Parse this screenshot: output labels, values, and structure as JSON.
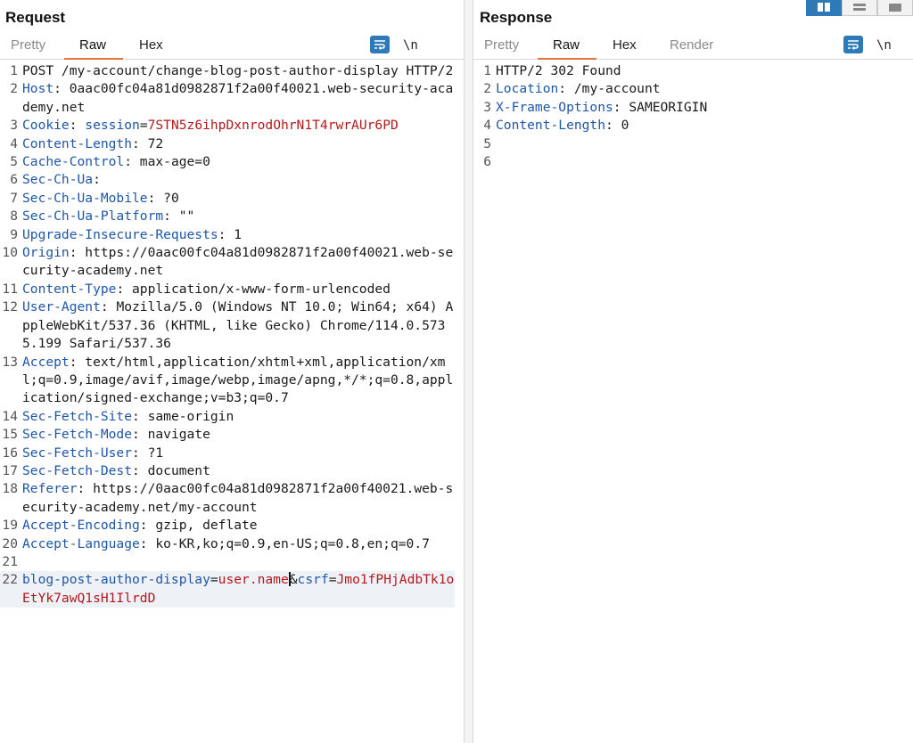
{
  "request": {
    "title": "Request",
    "tabs": [
      {
        "label": "Pretty",
        "active": false
      },
      {
        "label": "Raw",
        "active": true
      },
      {
        "label": "Hex",
        "active": false
      }
    ],
    "tools": {
      "wrap_icon": "wrap-lines-icon",
      "newline_label": "\\n",
      "menu_icon": "hamburger-menu-icon"
    },
    "lines": [
      {
        "n": "1",
        "parts": [
          {
            "t": "POST /my-account/change-blog-post-author-display HTTP/2",
            "c": "val"
          }
        ]
      },
      {
        "n": "2",
        "parts": [
          {
            "t": "Host",
            "c": "key"
          },
          {
            "t": ": 0aac00fc04a81d0982871f2a00f40021.web-security-academy.net",
            "c": "val"
          }
        ]
      },
      {
        "n": "3",
        "parts": [
          {
            "t": "Cookie",
            "c": "key"
          },
          {
            "t": ": ",
            "c": "val"
          },
          {
            "t": "session",
            "c": "key"
          },
          {
            "t": "=",
            "c": "val"
          },
          {
            "t": "7STN5z6ihpDxnrodOhrN1T4rwrAUr6PD",
            "c": "red"
          }
        ]
      },
      {
        "n": "4",
        "parts": [
          {
            "t": "Content-Length",
            "c": "key"
          },
          {
            "t": ": 72",
            "c": "val"
          }
        ]
      },
      {
        "n": "5",
        "parts": [
          {
            "t": "Cache-Control",
            "c": "key"
          },
          {
            "t": ": max-age=0",
            "c": "val"
          }
        ]
      },
      {
        "n": "6",
        "parts": [
          {
            "t": "Sec-Ch-Ua",
            "c": "key"
          },
          {
            "t": ":",
            "c": "val"
          }
        ]
      },
      {
        "n": "7",
        "parts": [
          {
            "t": "Sec-Ch-Ua-Mobile",
            "c": "key"
          },
          {
            "t": ": ?0",
            "c": "val"
          }
        ]
      },
      {
        "n": "8",
        "parts": [
          {
            "t": "Sec-Ch-Ua-Platform",
            "c": "key"
          },
          {
            "t": ": \"\"",
            "c": "val"
          }
        ]
      },
      {
        "n": "9",
        "parts": [
          {
            "t": "Upgrade-Insecure-Requests",
            "c": "key"
          },
          {
            "t": ": 1",
            "c": "val"
          }
        ]
      },
      {
        "n": "10",
        "parts": [
          {
            "t": "Origin",
            "c": "key"
          },
          {
            "t": ": https://0aac00fc04a81d0982871f2a00f40021.web-security-academy.net",
            "c": "val"
          }
        ]
      },
      {
        "n": "11",
        "parts": [
          {
            "t": "Content-Type",
            "c": "key"
          },
          {
            "t": ": application/x-www-form-urlencoded",
            "c": "val"
          }
        ]
      },
      {
        "n": "12",
        "parts": [
          {
            "t": "User-Agent",
            "c": "key"
          },
          {
            "t": ": Mozilla/5.0 (Windows NT 10.0; Win64; x64) AppleWebKit/537.36 (KHTML, like Gecko) Chrome/114.0.5735.199 Safari/537.36",
            "c": "val"
          }
        ]
      },
      {
        "n": "13",
        "parts": [
          {
            "t": "Accept",
            "c": "key"
          },
          {
            "t": ": text/html,application/xhtml+xml,application/xml;q=0.9,image/avif,image/webp,image/apng,*/*;q=0.8,application/signed-exchange;v=b3;q=0.7",
            "c": "val"
          }
        ]
      },
      {
        "n": "14",
        "parts": [
          {
            "t": "Sec-Fetch-Site",
            "c": "key"
          },
          {
            "t": ": same-origin",
            "c": "val"
          }
        ]
      },
      {
        "n": "15",
        "parts": [
          {
            "t": "Sec-Fetch-Mode",
            "c": "key"
          },
          {
            "t": ": navigate",
            "c": "val"
          }
        ]
      },
      {
        "n": "16",
        "parts": [
          {
            "t": "Sec-Fetch-User",
            "c": "key"
          },
          {
            "t": ": ?1",
            "c": "val"
          }
        ]
      },
      {
        "n": "17",
        "parts": [
          {
            "t": "Sec-Fetch-Dest",
            "c": "key"
          },
          {
            "t": ": document",
            "c": "val"
          }
        ]
      },
      {
        "n": "18",
        "parts": [
          {
            "t": "Referer",
            "c": "key"
          },
          {
            "t": ": https://0aac00fc04a81d0982871f2a00f40021.web-security-academy.net/my-account",
            "c": "val"
          }
        ]
      },
      {
        "n": "19",
        "parts": [
          {
            "t": "Accept-Encoding",
            "c": "key"
          },
          {
            "t": ": gzip, deflate",
            "c": "val"
          }
        ]
      },
      {
        "n": "20",
        "parts": [
          {
            "t": "Accept-Language",
            "c": "key"
          },
          {
            "t": ": ko-KR,ko;q=0.9,en-US;q=0.8,en;q=0.7",
            "c": "val"
          }
        ]
      },
      {
        "n": "21",
        "parts": []
      },
      {
        "n": "22",
        "highlight": true,
        "parts": [
          {
            "t": "blog-post-author-display",
            "c": "key"
          },
          {
            "t": "=",
            "c": "val"
          },
          {
            "t": "user.name",
            "c": "red"
          },
          {
            "caret": true
          },
          {
            "t": "&",
            "c": "val"
          },
          {
            "t": "csrf",
            "c": "key"
          },
          {
            "t": "=",
            "c": "val"
          },
          {
            "t": "Jmo1fPHjAdbTk1oEtYk7awQ1sH1IlrdD",
            "c": "red"
          }
        ]
      }
    ]
  },
  "response": {
    "title": "Response",
    "tabs": [
      {
        "label": "Pretty",
        "active": false
      },
      {
        "label": "Raw",
        "active": true
      },
      {
        "label": "Hex",
        "active": false
      },
      {
        "label": "Render",
        "active": false
      }
    ],
    "tools": {
      "wrap_icon": "wrap-lines-icon",
      "newline_label": "\\n",
      "menu_icon": "hamburger-menu-icon"
    },
    "lines": [
      {
        "n": "1",
        "parts": [
          {
            "t": "HTTP/2 302 Found",
            "c": "val"
          }
        ]
      },
      {
        "n": "2",
        "parts": [
          {
            "t": "Location",
            "c": "key"
          },
          {
            "t": ": /my-account",
            "c": "val"
          }
        ]
      },
      {
        "n": "3",
        "parts": [
          {
            "t": "X-Frame-Options",
            "c": "key"
          },
          {
            "t": ": SAMEORIGIN",
            "c": "val"
          }
        ]
      },
      {
        "n": "4",
        "parts": [
          {
            "t": "Content-Length",
            "c": "key"
          },
          {
            "t": ": 0",
            "c": "val"
          }
        ]
      },
      {
        "n": "5",
        "parts": []
      },
      {
        "n": "6",
        "parts": []
      }
    ]
  },
  "layout_toggle": {
    "icons": [
      "side-by-side-layout-icon",
      "stacked-layout-icon",
      "single-pane-layout-icon"
    ],
    "selected": 0
  },
  "colors": {
    "header_key": "#1f56a6",
    "value_red": "#b3181c",
    "accent_tab": "#e8743b",
    "button_blue": "#2e79b8"
  }
}
